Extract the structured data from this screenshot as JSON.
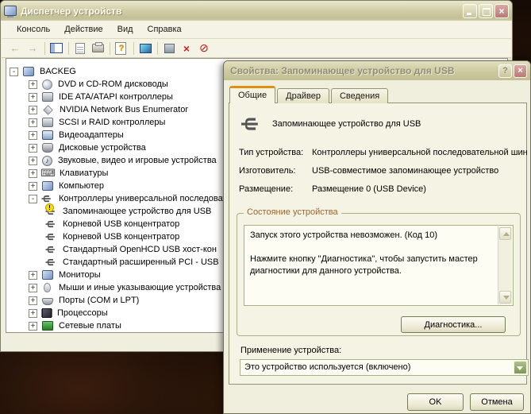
{
  "theme": {
    "titlebar_olive": "#d2cfa8",
    "window_bg": "#f0eedd",
    "active_tab_accent": "#e08f0e",
    "group_caption_color": "#996633",
    "warning_yellow": "#ffdf00",
    "button_border_green": "#71814d",
    "combo_button_green": "#8fa768"
  },
  "icons": {
    "back": "←",
    "forward": "→",
    "help": "?",
    "uninstall": "×",
    "disable": "⊘",
    "usb_trident": "ψ",
    "sound_note": "♪",
    "keyboard": "⌨",
    "warning": "!",
    "dialog_help": "?",
    "close": "×"
  },
  "main_window": {
    "title": "Диспетчер устройств",
    "menu": [
      {
        "label": "Консоль"
      },
      {
        "label": "Действие"
      },
      {
        "label": "Вид"
      },
      {
        "label": "Справка"
      }
    ]
  },
  "tree": {
    "items": [
      {
        "label": "BACKEG",
        "expander": "-"
      },
      {
        "label": "DVD и CD-ROM дисководы",
        "expander": "+"
      },
      {
        "label": "IDE ATA/ATAPI контроллеры",
        "expander": "+"
      },
      {
        "label": "NVIDIA Network Bus Enumerator",
        "expander": "+"
      },
      {
        "label": "SCSI и RAID контроллеры",
        "expander": "+"
      },
      {
        "label": "Видеоадаптеры",
        "expander": "+"
      },
      {
        "label": "Дисковые устройства",
        "expander": "+"
      },
      {
        "label": "Звуковые, видео и игровые устройства",
        "expander": "+"
      },
      {
        "label": "Клавиатуры",
        "expander": "+"
      },
      {
        "label": "Компьютер",
        "expander": "+"
      },
      {
        "label": "Контроллеры универсальной последоват",
        "expander": "-"
      },
      {
        "label": "Запоминающее устройство для USB",
        "expander": ""
      },
      {
        "label": "Корневой USB концентратор",
        "expander": ""
      },
      {
        "label": "Корневой USB концентратор",
        "expander": ""
      },
      {
        "label": "Стандартный OpenHCD USB хост-кон",
        "expander": ""
      },
      {
        "label": "Стандартный расширенный PCI - USB",
        "expander": ""
      },
      {
        "label": "Мониторы",
        "expander": "+"
      },
      {
        "label": "Мыши и иные указывающие устройства",
        "expander": "+"
      },
      {
        "label": "Порты (COM и LPT)",
        "expander": "+"
      },
      {
        "label": "Процессоры",
        "expander": "+"
      },
      {
        "label": "Сетевые платы",
        "expander": "+"
      }
    ]
  },
  "dialog": {
    "title": "Свойства: Запоминающее устройство для USB",
    "tabs": [
      {
        "label": "Общие"
      },
      {
        "label": "Драйвер"
      },
      {
        "label": "Сведения"
      }
    ],
    "device_name": "Запоминающее устройство для USB",
    "fields": [
      {
        "label": "Тип устройства:",
        "value": "Контроллеры универсальной последовательной шин"
      },
      {
        "label": "Изготовитель:",
        "value": "USB-совместимое запоминающее устройство"
      },
      {
        "label": "Размещение:",
        "value": "Размещение 0 (USB Device)"
      }
    ],
    "status_group": {
      "title": "Состояние устройства",
      "line1": "Запуск этого устройства невозможен. (Код 10)",
      "line2": "Нажмите кнопку \"Диагностика\", чтобы запустить мастер диагностики для данного устройства.",
      "diagnostics_button": "Диагностика..."
    },
    "usage": {
      "label": "Применение устройства:",
      "value": "Это устройство используется (включено)"
    },
    "ok_button": "OK",
    "cancel_button": "Отмена"
  }
}
